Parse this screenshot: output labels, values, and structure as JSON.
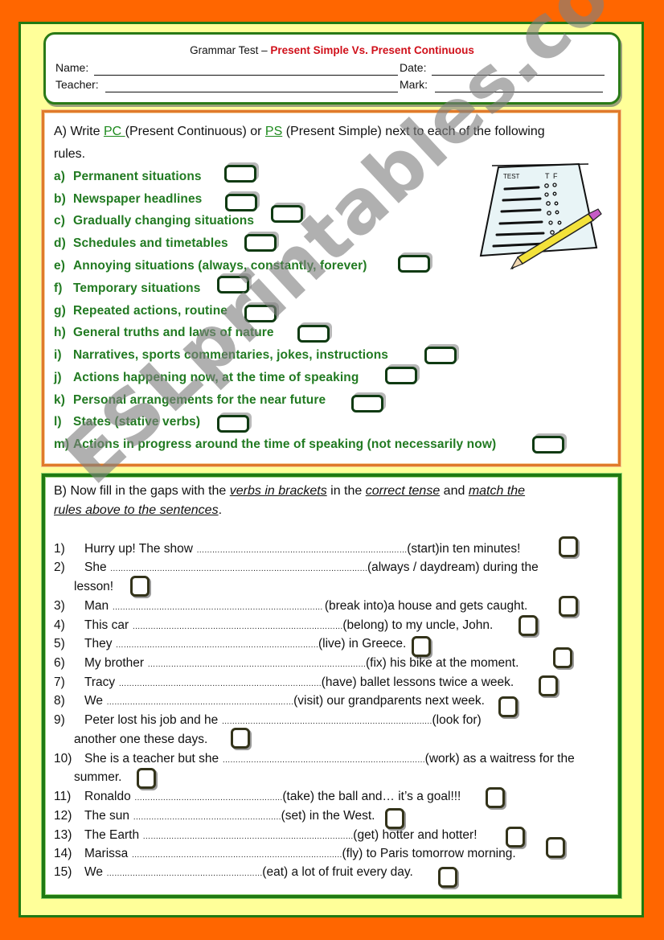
{
  "header": {
    "title_prefix": "Grammar Test – ",
    "title_main": "Present Simple Vs. Present Continuous",
    "name_label": "Name:",
    "date_label": "Date:",
    "teacher_label": "Teacher:",
    "mark_label": "Mark:"
  },
  "section_a": {
    "intro_1": "A) Write ",
    "kw_pc": "PC ",
    "intro_2": "(Present Continuous) or ",
    "kw_ps": "PS",
    "intro_3": " (Present Simple) next to each of the following",
    "intro_line2": "rules.",
    "items": [
      {
        "letter": "a)",
        "text": "Permanent situations"
      },
      {
        "letter": "b)",
        "text": "Newspaper headlines"
      },
      {
        "letter": "c)",
        "text": "Gradually changing situations"
      },
      {
        "letter": "d)",
        "text": "Schedules and timetables"
      },
      {
        "letter": "e)",
        "text": "Annoying situations (always, constantly, forever)"
      },
      {
        "letter": "f)",
        "text": "Temporary situations"
      },
      {
        "letter": "g)",
        "text": "Repeated actions, routine"
      },
      {
        "letter": "h)",
        "text": "General truths and laws of nature"
      },
      {
        "letter": "i)",
        "text": "Narratives, sports commentaries, jokes, instructions"
      },
      {
        "letter": "j)",
        "text": "Actions happening now, at the time of speaking"
      },
      {
        "letter": "k)",
        "text": "Personal arrangements for the near future"
      },
      {
        "letter": "l)",
        "text": "States (stative verbs)"
      },
      {
        "letter": "m)",
        "text": "Actions in progress around the time of speaking (not necessarily now)"
      }
    ],
    "clipart": {
      "test_label": "TEST",
      "t_label": "T",
      "f_label": "F"
    }
  },
  "section_b": {
    "intro_1": "B) Now fill in the gaps with the ",
    "em_1": "verbs in brackets",
    "intro_2": " in the ",
    "em_2": "correct tense",
    "intro_3": " and ",
    "em_3": "match the",
    "em_4": "rules above to the sentences",
    "intro_4": ".",
    "sentences": [
      {
        "num": "1)",
        "before": "Hurry up! The show ",
        "gap": "………………………………………………………………………",
        "after": "(start)in ten minutes!",
        "cont": ""
      },
      {
        "num": "2)",
        "before": "She ",
        "gap": "………………………………………………………………………………………",
        "after": "(always / daydream) during the",
        "cont": "lesson!"
      },
      {
        "num": "3)",
        "before": "Man ",
        "gap": "……………………………………………………………………… ",
        "after": "(break into)a house and gets caught.",
        "cont": ""
      },
      {
        "num": "4)",
        "before": "This car ",
        "gap": "………………………………………………………………………",
        "after": "(belong) to my uncle, John.",
        "cont": ""
      },
      {
        "num": "5)",
        "before": "They ",
        "gap": "……………………………………………………………………",
        "after": "(live) in Greece.",
        "cont": ""
      },
      {
        "num": "6)",
        "before": "My brother ",
        "gap": "…………………………………………………………………………",
        "after": "(fix) his bike at the moment.",
        "cont": ""
      },
      {
        "num": "7)",
        "before": "Tracy ",
        "gap": "……………………………………………………………………",
        "after": "(have) ballet lessons twice a week.",
        "cont": ""
      },
      {
        "num": "8)",
        "before": "We ",
        "gap": "………………………………………………………………",
        "after": "(visit) our grandparents next week.",
        "cont": ""
      },
      {
        "num": "9)",
        "before": "Peter lost his job and he ",
        "gap": "………………………………………………………………………",
        "after": "(look for)",
        "cont": "another one these days."
      },
      {
        "num": "10)",
        "before": "She is a teacher but she ",
        "gap": "……………………………………………………………………",
        "after": "(work) as a waitress for the",
        "cont": "summer."
      },
      {
        "num": "11)",
        "before": "Ronaldo ",
        "gap": "…………………………………………………",
        "after": "(take) the ball and… it’s a goal!!!",
        "cont": ""
      },
      {
        "num": "12)",
        "before": "The sun ",
        "gap": "…………………………………………………",
        "after": "(set) in the West.",
        "cont": ""
      },
      {
        "num": "13)",
        "before": "The Earth ",
        "gap": "………………………………………………………………………",
        "after": "(get) hotter and hotter!",
        "cont": ""
      },
      {
        "num": "14)",
        "before": "Marissa ",
        "gap": "………………………………………………………………………",
        "after": "(fly) to Paris tomorrow morning.",
        "cont": ""
      },
      {
        "num": "15)",
        "before": "We ",
        "gap": "……………………………………………………",
        "after": "(eat) a lot of fruit every day.",
        "cont": ""
      }
    ]
  },
  "watermark": "ESLprintables.com",
  "colors": {
    "page_orange": "#ff6600",
    "frame_yellow": "#ffff99",
    "frame_green": "#1f7a12",
    "title_red": "#d0101a",
    "rule_green": "#217a21",
    "box_a_border": "#e07a2a"
  }
}
